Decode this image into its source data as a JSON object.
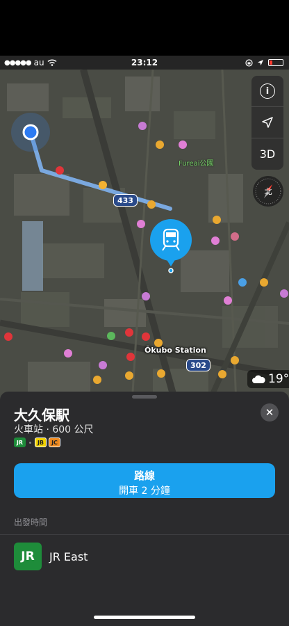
{
  "status_bar": {
    "carrier": "au",
    "time": "23:12"
  },
  "map": {
    "road_badges": [
      "433",
      "302"
    ],
    "station_label": "Ōkubo Station",
    "park_label": "Fureai公園",
    "controls": {
      "info_label": "i",
      "view_mode_label": "3D"
    },
    "compass_label": "北",
    "weather": {
      "temperature": "19°"
    }
  },
  "place_card": {
    "title": "大久保駅",
    "subtitle": "火車站 · 600 公尺",
    "line_badges": [
      "JR",
      "JB",
      "JC"
    ],
    "route_button": {
      "label": "路線",
      "sublabel": "開車 2 分鐘"
    },
    "departures_label": "出發時間",
    "operator": {
      "logo_text": "JR",
      "name": "JR East"
    }
  },
  "colors": {
    "accent_blue": "#1aa1ee",
    "jr_green": "#1e8c3a",
    "route_line": "#7fb2ef"
  }
}
